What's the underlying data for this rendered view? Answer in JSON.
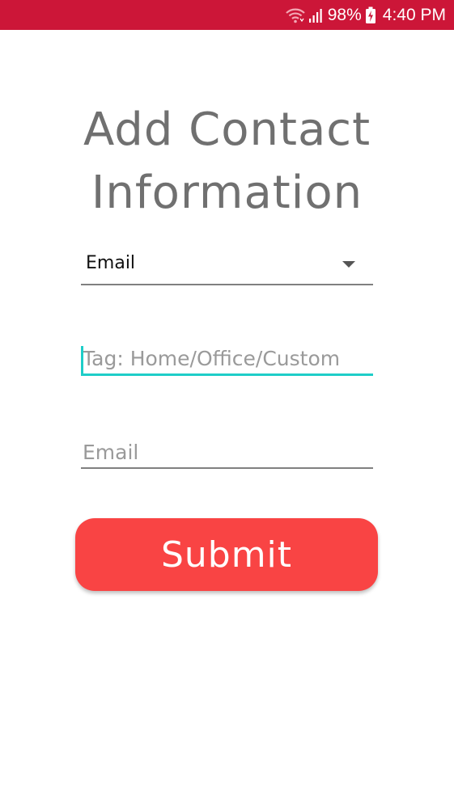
{
  "status_bar": {
    "battery_percent": "98%",
    "time": "4:40 PM",
    "icons": [
      "wifi-icon",
      "signal-icon",
      "battery-charging-icon"
    ],
    "background_color": "#cc1638"
  },
  "form": {
    "title_line1": "Add Contact",
    "title_line2": "Information",
    "type_dropdown": {
      "selected": "Email"
    },
    "tag_input": {
      "value": "",
      "placeholder": "Tag: Home/Office/Custom"
    },
    "email_input": {
      "value": "",
      "placeholder": "Email"
    },
    "submit_label": "Submit"
  },
  "colors": {
    "accent": "#1ecdc8",
    "button": "#f94444",
    "title_text": "#707070"
  }
}
